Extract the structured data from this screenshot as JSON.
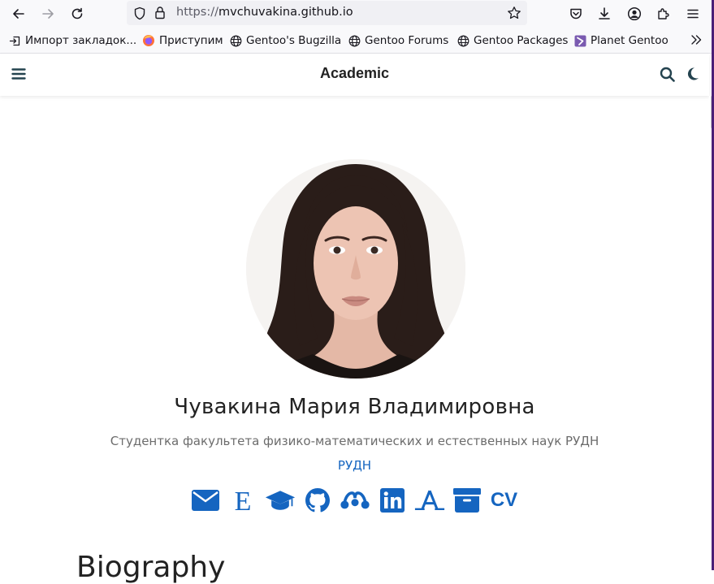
{
  "browser": {
    "url_scheme": "https://",
    "url_host": "mvchuvakina.github.io",
    "bookmarks": [
      {
        "label": "Импорт закладок..."
      },
      {
        "label": "Приступим"
      },
      {
        "label": "Gentoo's Bugzilla"
      },
      {
        "label": "Gentoo Forums"
      },
      {
        "label": "Gentoo Packages"
      },
      {
        "label": "Planet Gentoo"
      }
    ]
  },
  "site": {
    "title": "Academic"
  },
  "profile": {
    "name": "Чувакина Мария Владимировна",
    "role": "Студентка факультета физико-математических и естественных наук РУДН",
    "organization": "РУДН",
    "cv_label": "CV"
  },
  "sections": {
    "biography": "Biography"
  },
  "colors": {
    "accent": "#1565c0"
  }
}
